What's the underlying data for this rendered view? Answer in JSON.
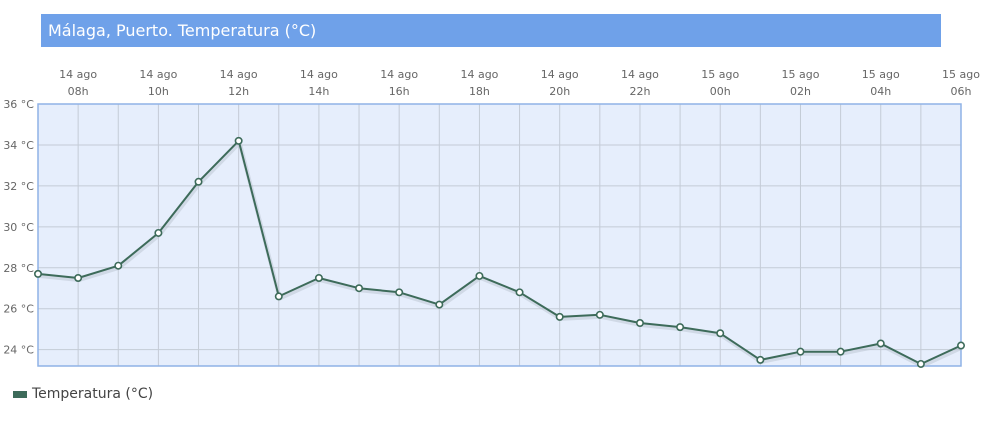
{
  "title": "Málaga, Puerto. Temperatura (°C)",
  "colors": {
    "title_bg": "#6fa1e9",
    "plot_bg": "#e6eefc",
    "plot_border": "#8fb2e6",
    "grid": "#c4cbd6",
    "line": "#3d6b5a",
    "point_fill": "#ffffff"
  },
  "chart_data": {
    "type": "line",
    "title": "Málaga, Puerto. Temperatura (°C)",
    "x": [
      "14 ago 07h",
      "14 ago 08h",
      "14 ago 09h",
      "14 ago 10h",
      "14 ago 11h",
      "14 ago 12h",
      "14 ago 13h",
      "14 ago 14h",
      "14 ago 15h",
      "14 ago 16h",
      "14 ago 17h",
      "14 ago 18h",
      "14 ago 19h",
      "14 ago 20h",
      "14 ago 21h",
      "14 ago 22h",
      "14 ago 23h",
      "15 ago 00h",
      "15 ago 01h",
      "15 ago 02h",
      "15 ago 03h",
      "15 ago 04h",
      "15 ago 05h",
      "15 ago 06h"
    ],
    "series": [
      {
        "name": "Temperatura (°C)",
        "values": [
          27.7,
          27.5,
          28.1,
          29.7,
          32.2,
          34.2,
          26.6,
          27.5,
          27.0,
          26.8,
          26.2,
          27.6,
          26.8,
          25.6,
          25.7,
          25.3,
          25.1,
          24.8,
          23.5,
          23.9,
          23.9,
          24.3,
          23.3,
          24.2
        ]
      }
    ],
    "x_tick_labels": [
      {
        "index": 1,
        "line1": "14 ago",
        "line2": "08h"
      },
      {
        "index": 3,
        "line1": "14 ago",
        "line2": "10h"
      },
      {
        "index": 5,
        "line1": "14 ago",
        "line2": "12h"
      },
      {
        "index": 7,
        "line1": "14 ago",
        "line2": "14h"
      },
      {
        "index": 9,
        "line1": "14 ago",
        "line2": "16h"
      },
      {
        "index": 11,
        "line1": "14 ago",
        "line2": "18h"
      },
      {
        "index": 13,
        "line1": "14 ago",
        "line2": "20h"
      },
      {
        "index": 15,
        "line1": "14 ago",
        "line2": "22h"
      },
      {
        "index": 17,
        "line1": "15 ago",
        "line2": "00h"
      },
      {
        "index": 19,
        "line1": "15 ago",
        "line2": "02h"
      },
      {
        "index": 21,
        "line1": "15 ago",
        "line2": "04h"
      },
      {
        "index": 23,
        "line1": "15 ago",
        "line2": "06h"
      }
    ],
    "y_ticks": [
      24,
      26,
      28,
      30,
      32,
      34,
      36
    ],
    "y_tick_suffix": " °C",
    "ylim": [
      23.2,
      36
    ],
    "grid": true,
    "legend": "bottom-left"
  },
  "legend": {
    "label": "Temperatura (°C)"
  }
}
